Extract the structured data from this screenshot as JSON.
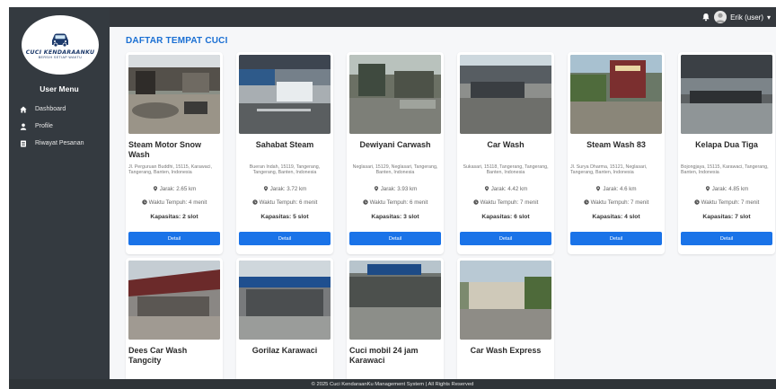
{
  "user": {
    "name": "Erik (user)"
  },
  "brand": {
    "name": "CUCI KENDARAANKU",
    "tagline": "BERSIH SETIAP WAKTU"
  },
  "sidebar": {
    "heading": "User Menu",
    "items": [
      {
        "label": "Dashboard",
        "icon": "home-icon"
      },
      {
        "label": "Profile",
        "icon": "user-icon"
      },
      {
        "label": "Riwayat Pesanan",
        "icon": "list-icon"
      }
    ]
  },
  "page": {
    "title": "DAFTAR TEMPAT CUCI"
  },
  "cards": [
    {
      "name": "Steam Motor Snow Wash",
      "address": "Jl. Perguruan Buddhi, 15115, Karawaci, Tangerang, Banten, Indonesia",
      "distance": "Jarak: 2.65 km",
      "time": "Waktu Tempuh: 4 menit",
      "capacity": "Kapasitas: 2 slot",
      "button": "Detail"
    },
    {
      "name": "Sahabat Steam",
      "address": "Bueran Indah, 15119, Tangerang, Tangerang, Banten, Indonesia",
      "distance": "Jarak: 3.72 km",
      "time": "Waktu Tempuh: 6 menit",
      "capacity": "Kapasitas: 5 slot",
      "button": "Detail"
    },
    {
      "name": "Dewiyani Carwash",
      "address": "Neglasari, 15129, Neglasari, Tangerang, Banten, Indonesia",
      "distance": "Jarak: 3.93 km",
      "time": "Waktu Tempuh: 6 menit",
      "capacity": "Kapasitas: 3 slot",
      "button": "Detail"
    },
    {
      "name": "Car Wash",
      "address": "Sukasari, 15118, Tangerang, Tangerang, Banten, Indonesia",
      "distance": "Jarak: 4.42 km",
      "time": "Waktu Tempuh: 7 menit",
      "capacity": "Kapasitas: 6 slot",
      "button": "Detail"
    },
    {
      "name": "Steam Wash 83",
      "address": "Jl. Surya Dharma, 15121, Neglasari, Tangerang, Banten, Indonesia",
      "distance": "Jarak: 4.6 km",
      "time": "Waktu Tempuh: 7 menit",
      "capacity": "Kapasitas: 4 slot",
      "button": "Detail"
    },
    {
      "name": "Kelapa Dua Tiga",
      "address": "Bojongjaya, 15115, Karawaci, Tangerang, Banten, Indonesia",
      "distance": "Jarak: 4.85 km",
      "time": "Waktu Tempuh: 7 menit",
      "capacity": "Kapasitas: 7 slot",
      "button": "Detail"
    },
    {
      "name": "Dees Car Wash Tangcity"
    },
    {
      "name": "Gorilaz Karawaci"
    },
    {
      "name": "Cuci mobil 24 jam Karawaci"
    },
    {
      "name": "Car Wash Express"
    }
  ],
  "footer": {
    "text": "© 2025 Cuci KendaraanKu Management System | All Rights Reserved"
  },
  "colors": {
    "accent": "#1a73e8",
    "title": "#1a6fd3",
    "sidebar": "#343a40",
    "topbar": "#34383d"
  }
}
